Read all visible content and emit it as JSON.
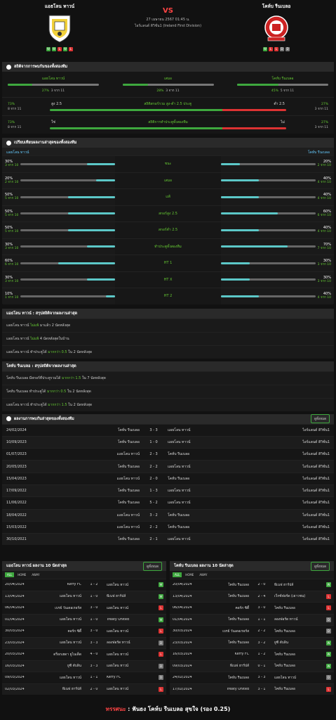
{
  "match": {
    "home": "แอธโลน ทาวน์",
    "away": "โคห์บ รีนเบลอ",
    "vs": "VS",
    "datetime": "27 เมษายน 2567 01:45 น.",
    "league": "ไอร์แลนด์ ดิวิชั่น1 (Ireland First Division)",
    "home_form": [
      "W",
      "W",
      "L",
      "W",
      "L"
    ],
    "away_form": [
      "W",
      "L",
      "L",
      "D",
      "D"
    ]
  },
  "h2h_stats": {
    "title": "สถิติจากการพบกันของทั้งสองทีม",
    "home": {
      "label": "แอธโลน ทาวน์",
      "pct": "27%",
      "games": "3 จาก 11",
      "value": 27
    },
    "draw": {
      "label": "เสมอ",
      "pct": "28%",
      "games": "3 จาก 11",
      "value": 28
    },
    "away": {
      "label": "โคห์บ รีนเบลอ",
      "pct": "45%",
      "games": "5 จาก 11",
      "value": 45
    },
    "ou": {
      "left_pct": "73%",
      "left_games": "8 จาก 11",
      "over_label": "สูง 2.5",
      "title": "สถิติสกอร์รวม สูง-ต่ำ 2.5 ประตู",
      "under_label": "ต่ำ 2.5",
      "right_pct": "27%",
      "right_games": "3 จาก 11",
      "value": 73
    },
    "btts": {
      "left_pct": "73%",
      "left_games": "8 จาก 11",
      "yes_label": "ใช่",
      "title": "สถิติการทำประตูทั้งสองทีม",
      "no_label": "ไม่",
      "right_pct": "27%",
      "right_games": "3 จาก 11",
      "value": 73
    }
  },
  "compare": {
    "title": "เปรียบเทียบผลงานล่าสุดของทั้งสองทีม",
    "home": "แอธโลน ทาวน์",
    "away": "โคห์บ รีนเบลอ",
    "rows": [
      {
        "label": "ชนะ",
        "hp": "30%",
        "hg": "3 จาก 10",
        "hv": 30,
        "ap": "20%",
        "ag": "2 จาก 10",
        "av": 20
      },
      {
        "label": "เสมอ",
        "hp": "20%",
        "hg": "2 จาก 10",
        "hv": 20,
        "ap": "40%",
        "ag": "4 จาก 10",
        "av": 40
      },
      {
        "label": "แพ้",
        "hp": "50%",
        "hg": "5 จาก 10",
        "hv": 50,
        "ap": "40%",
        "ag": "4 จาก 10",
        "av": 40
      },
      {
        "label": "สกอร์สูง 2.5",
        "hp": "50%",
        "hg": "5 จาก 10",
        "hv": 50,
        "ap": "60%",
        "ag": "6 จาก 10",
        "av": 60
      },
      {
        "label": "สกอร์ต่ำ 2.5",
        "hp": "50%",
        "hg": "5 จาก 10",
        "hv": 50,
        "ap": "40%",
        "ag": "4 จาก 10",
        "av": 40
      },
      {
        "label": "ทำประตูทั้งสองทีม",
        "hp": "30%",
        "hg": "3 จาก 10",
        "hv": 30,
        "ap": "70%",
        "ag": "7 จาก 10",
        "av": 70
      },
      {
        "label": "HT 1",
        "hp": "60%",
        "hg": "6 จาก 10",
        "hv": 60,
        "ap": "30%",
        "ag": "3 จาก 10",
        "av": 30
      },
      {
        "label": "HT X",
        "hp": "30%",
        "hg": "3 จาก 10",
        "hv": 30,
        "ap": "30%",
        "ag": "3 จาก 10",
        "av": 30
      },
      {
        "label": "HT 2",
        "hp": "10%",
        "hg": "1 จาก 10",
        "hv": 10,
        "ap": "40%",
        "ag": "4 จาก 10",
        "av": 40
      }
    ]
  },
  "home_summary": {
    "title": "แอธโลน ทาวน์ : สรุปสถิติจากผลงานล่าสุด",
    "lines": [
      [
        "แอธโลน ทาวน์",
        "ไม่แพ้",
        " มาแล้ว 2 นัดหลังสุด"
      ],
      [
        "แอธโลน ทาวน์",
        "ไม่แพ้",
        " 4  นัดหลังสุดในบ้าน"
      ],
      [
        "แอธโลน ทาวน์ ทำประตูได้",
        "มากกว่า 0.5",
        " ใน 2 นัดหลังสุด"
      ]
    ]
  },
  "away_summary": {
    "title": "โคห์บ รีนเบลอ : สรุปสถิติจากผลงานล่าสุด",
    "lines": [
      [
        "โคห์บ รีนเบลอ มีสกอร์ที่ประตูรวมได้",
        "มากกว่า 1.5",
        " ใน 7 นัดหลังสุด"
      ],
      [
        "โคห์บ รีนเบลอ ทำประตูได้",
        "มากกว่า 0.5",
        " ใน 2 นัดหลังสุด"
      ],
      [
        "แอธโลน ทาวน์ ทำประตูได้",
        "มากกว่า 1.5",
        " ใน 2 นัดหลังสุด"
      ]
    ]
  },
  "h2h_matches": {
    "title": "ผลงานการพบกันล่าสุดของทั้งสองทีม",
    "btn": "ดูทั้งหมด",
    "rows": [
      [
        "24/02/2024",
        "โคห์บ รีนเบลอ",
        "3 - 3",
        "แอธโลน ทาวน์",
        "ไอร์แลนด์ ดิวิชั่น1"
      ],
      [
        "10/09/2023",
        "โคห์บ รีนเบลอ",
        "1 - 0",
        "แอธโลน ทาวน์",
        "ไอร์แลนด์ ดิวิชั่น1"
      ],
      [
        "01/07/2023",
        "แอธโลน ทาวน์",
        "2 - 3",
        "โคห์บ รีนเบลอ",
        "ไอร์แลนด์ ดิวิชั่น1"
      ],
      [
        "20/05/2023",
        "โคห์บ รีนเบลอ",
        "2 - 2",
        "แอธโลน ทาวน์",
        "ไอร์แลนด์ ดิวิชั่น1"
      ],
      [
        "15/04/2023",
        "แอธโลน ทาวน์",
        "2 - 0",
        "โคห์บ รีนเบลอ",
        "ไอร์แลนด์ ดิวิชั่น1"
      ],
      [
        "17/09/2022",
        "โคห์บ รีนเบลอ",
        "1 - 3",
        "แอธโลน ทาวน์",
        "ไอร์แลนด์ ดิวิชั่น1"
      ],
      [
        "11/06/2022",
        "โคห์บ รีนเบลอ",
        "5 - 2",
        "แอธโลน ทาวน์",
        "ไอร์แลนด์ ดิวิชั่น1"
      ],
      [
        "18/04/2022",
        "แอธโลน ทาวน์",
        "3 - 2",
        "โคห์บ รีนเบลอ",
        "ไอร์แลนด์ ดิวิชั่น1"
      ],
      [
        "15/03/2022",
        "แอธโลน ทาวน์",
        "2 - 2",
        "โคห์บ รีนเบลอ",
        "ไอร์แลนด์ ดิวิชั่น1"
      ],
      [
        "30/10/2021",
        "โคห์บ รีนเบลอ",
        "2 - 1",
        "แอธโลน ทาวน์",
        "ไอร์แลนด์ ดิวิชั่น1"
      ]
    ]
  },
  "home_last10": {
    "title": "แอธโลน ทาวน์ ผลงาน 10 นัดล่าสุด",
    "btn": "ดูทั้งหมด",
    "tabs": [
      "ALL",
      "HOME",
      "AWAY"
    ],
    "rows": [
      [
        "20/04/2024",
        "Kerry FC",
        "1 - 2",
        "แอธโลน ทาวน์",
        "W"
      ],
      [
        "13/04/2024",
        "แอธโลน ทาวน์",
        "1 - 0",
        "พีเนฟ ฮาร์ปส์",
        "W"
      ],
      [
        "06/04/2024",
        "เบรย์ วันเดอเรอร์ส",
        "3 - 0",
        "แอธโลน ทาวน์",
        "L"
      ],
      [
        "01/04/2024",
        "แอธโลน ทาวน์",
        "1 - 0",
        "Treaty United",
        "W"
      ],
      [
        "30/03/2024",
        "คอร์ก ซิตี้",
        "3 - 0",
        "แอธโลน ทาวน์",
        "L"
      ],
      [
        "23/03/2024",
        "แอธโลน ทาวน์",
        "3 - 3",
        "ลองฟอร์ด ทาวน์",
        "D"
      ],
      [
        "20/03/2024",
        "ดร็อกเฮดา ยูไนเต็ด",
        "4 - 0",
        "แอธโลน ทาวน์",
        "L"
      ],
      [
        "16/03/2024",
        "ยูซี ดับลิน",
        "3 - 3",
        "แอธโลน ทาวน์",
        "D"
      ],
      [
        "09/03/2024",
        "แอธโลน ทาวน์",
        "1 - 1",
        "Kerry FC",
        "D"
      ],
      [
        "02/03/2024",
        "พีเนฟ ฮาร์ปส์",
        "2 - 0",
        "แอธโลน ทาวน์",
        "L"
      ]
    ]
  },
  "away_last10": {
    "title": "โคห์บ รีนเบลอ ผลงาน 10 นัดล่าสุด",
    "btn": "ดูทั้งหมด",
    "tabs": [
      "ALL",
      "HOME",
      "AWAY"
    ],
    "rows": [
      [
        "20/04/2024",
        "โคห์บ รีนเบลอ",
        "2 - 0",
        "พีเนฟ ฮาร์ปส์",
        "W"
      ],
      [
        "13/04/2024",
        "โคห์บ รีนเบลอ",
        "2 - 4",
        "เว็กซ์ฟอร์ด (เยาวชน)",
        "L"
      ],
      [
        "06/04/2024",
        "คอร์ก ซิตี้",
        "3 - 0",
        "โคห์บ รีนเบลอ",
        "L"
      ],
      [
        "01/04/2024",
        "โคห์บ รีนเบลอ",
        "1 - 1",
        "ลองฟอร์ด ทาวน์",
        "D"
      ],
      [
        "30/03/2024",
        "เบรย์ วันเดอเรอร์ส",
        "2 - 2",
        "โคห์บ รีนเบลอ",
        "D"
      ],
      [
        "23/03/2024",
        "โคห์บ รีนเบลอ",
        "3 - 2",
        "ยูซี ดับลิน",
        "W"
      ],
      [
        "16/03/2024",
        "Kerry FC",
        "1 - 2",
        "โคห์บ รีนเบลอ",
        "W"
      ],
      [
        "09/03/2024",
        "พีเนฟ ฮาร์ปส์",
        "0 - 1",
        "โคห์บ รีนเบลอ",
        "W"
      ],
      [
        "24/02/2024",
        "โคห์บ รีนเบลอ",
        "3 - 3",
        "แอธโลน ทาวน์",
        "D"
      ],
      [
        "17/02/2024",
        "Treaty United",
        "3 - 1",
        "โคห์บ รีนเบลอ",
        "L"
      ]
    ]
  },
  "prediction": {
    "label": "ทรรศนะ",
    "colon": " : ",
    "text": "ฟันธง โคห์บ รีนเบลอ สุขใจ (รอง 0.25)"
  },
  "colors": {
    "accent": "#3ea83e",
    "red": "#dd3333",
    "cyan": "#5cc8c8"
  }
}
